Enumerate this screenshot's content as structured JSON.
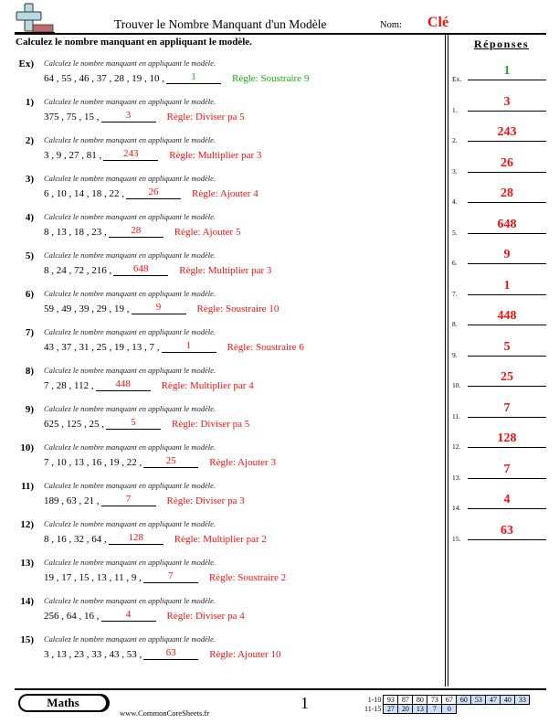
{
  "header": {
    "title": "Trouver le Nombre Manquant d'un Modèle",
    "nom_label": "Nom:",
    "nom_value": "Clé",
    "instructions": "Calculez le nombre manquant en appliquant le modèle."
  },
  "colors": {
    "answer_red": "#ee1111",
    "example_green": "#1aa61a",
    "logo_blue": "#b7dbe3",
    "logo_red": "#c06b6b",
    "score_blue": "#cce0f7"
  },
  "problems": [
    {
      "num": "Ex)",
      "prompt": "Calculez le nombre manquant en appliquant le modèle.",
      "sequence": "64 , 55 , 46 , 37 , 28 , 19 , 10 ,",
      "answer": "1",
      "rule": "Règle: Soustraire 9"
    },
    {
      "num": "1)",
      "prompt": "Calculez le nombre manquant en appliquant le modèle.",
      "sequence": "375 , 75 , 15 ,",
      "answer": "3",
      "rule": "Règle: Diviser pa 5"
    },
    {
      "num": "2)",
      "prompt": "Calculez le nombre manquant en appliquant le modèle.",
      "sequence": "3 , 9 , 27 , 81 ,",
      "answer": "243",
      "rule": "Règle: Multiplier par 3"
    },
    {
      "num": "3)",
      "prompt": "Calculez le nombre manquant en appliquant le modèle.",
      "sequence": "6 , 10 , 14 , 18 , 22 ,",
      "answer": "26",
      "rule": "Règle: Ajouter 4"
    },
    {
      "num": "4)",
      "prompt": "Calculez le nombre manquant en appliquant le modèle.",
      "sequence": "8 , 13 , 18 , 23 ,",
      "answer": "28",
      "rule": "Règle: Ajouter 5"
    },
    {
      "num": "5)",
      "prompt": "Calculez le nombre manquant en appliquant le modèle.",
      "sequence": "8 , 24 , 72 , 216 ,",
      "answer": "648",
      "rule": "Règle: Multiplier par 3"
    },
    {
      "num": "6)",
      "prompt": "Calculez le nombre manquant en appliquant le modèle.",
      "sequence": "59 , 49 , 39 , 29 , 19 ,",
      "answer": "9",
      "rule": "Règle: Soustraire 10"
    },
    {
      "num": "7)",
      "prompt": "Calculez le nombre manquant en appliquant le modèle.",
      "sequence": "43 , 37 , 31 , 25 , 19 , 13 , 7 ,",
      "answer": "1",
      "rule": "Règle: Soustraire 6"
    },
    {
      "num": "8)",
      "prompt": "Calculez le nombre manquant en appliquant le modèle.",
      "sequence": "7 , 28 , 112 ,",
      "answer": "448",
      "rule": "Règle: Multiplier par 4"
    },
    {
      "num": "9)",
      "prompt": "Calculez le nombre manquant en appliquant le modèle.",
      "sequence": "625 , 125 , 25 ,",
      "answer": "5",
      "rule": "Règle: Diviser pa 5"
    },
    {
      "num": "10)",
      "prompt": "Calculez le nombre manquant en appliquant le modèle.",
      "sequence": "7 , 10 , 13 , 16 , 19 , 22 ,",
      "answer": "25",
      "rule": "Règle: Ajouter 3"
    },
    {
      "num": "11)",
      "prompt": "Calculez le nombre manquant en appliquant le modèle.",
      "sequence": "189 , 63 , 21 ,",
      "answer": "7",
      "rule": "Règle: Diviser pa 3"
    },
    {
      "num": "12)",
      "prompt": "Calculez le nombre manquant en appliquant le modèle.",
      "sequence": "8 , 16 , 32 , 64 ,",
      "answer": "128",
      "rule": "Règle: Multiplier par 2"
    },
    {
      "num": "13)",
      "prompt": "Calculez le nombre manquant en appliquant le modèle.",
      "sequence": "19 , 17 , 15 , 13 , 11 , 9 ,",
      "answer": "7",
      "rule": "Règle: Soustraire 2"
    },
    {
      "num": "14)",
      "prompt": "Calculez le nombre manquant en appliquant le modèle.",
      "sequence": "256 , 64 , 16 ,",
      "answer": "4",
      "rule": "Règle: Diviser pa 4"
    },
    {
      "num": "15)",
      "prompt": "Calculez le nombre manquant en appliquant le modèle.",
      "sequence": "3 , 13 , 23 , 33 , 43 , 53 ,",
      "answer": "63",
      "rule": "Règle: Ajouter 10"
    }
  ],
  "answers": {
    "title": "Réponses",
    "items": [
      {
        "label": "Ex.",
        "value": "1"
      },
      {
        "label": "1.",
        "value": "3"
      },
      {
        "label": "2.",
        "value": "243"
      },
      {
        "label": "3.",
        "value": "26"
      },
      {
        "label": "4.",
        "value": "28"
      },
      {
        "label": "5.",
        "value": "648"
      },
      {
        "label": "6.",
        "value": "9"
      },
      {
        "label": "7.",
        "value": "1"
      },
      {
        "label": "8.",
        "value": "448"
      },
      {
        "label": "9.",
        "value": "5"
      },
      {
        "label": "10.",
        "value": "25"
      },
      {
        "label": "11.",
        "value": "7"
      },
      {
        "label": "12.",
        "value": "128"
      },
      {
        "label": "13.",
        "value": "7"
      },
      {
        "label": "14.",
        "value": "4"
      },
      {
        "label": "15.",
        "value": "63"
      }
    ]
  },
  "footer": {
    "subject": "Maths",
    "website": "www.CommonCoreSheets.fr",
    "page_number": "1",
    "score_rows": [
      {
        "label": "1-10",
        "scores": [
          "93",
          "87",
          "80",
          "73",
          "67",
          "60",
          "53",
          "47",
          "40",
          "33"
        ],
        "blue_from": 5
      },
      {
        "label": "11-15",
        "scores": [
          "27",
          "20",
          "13",
          "7",
          "0"
        ],
        "blue_from": 0
      }
    ]
  }
}
